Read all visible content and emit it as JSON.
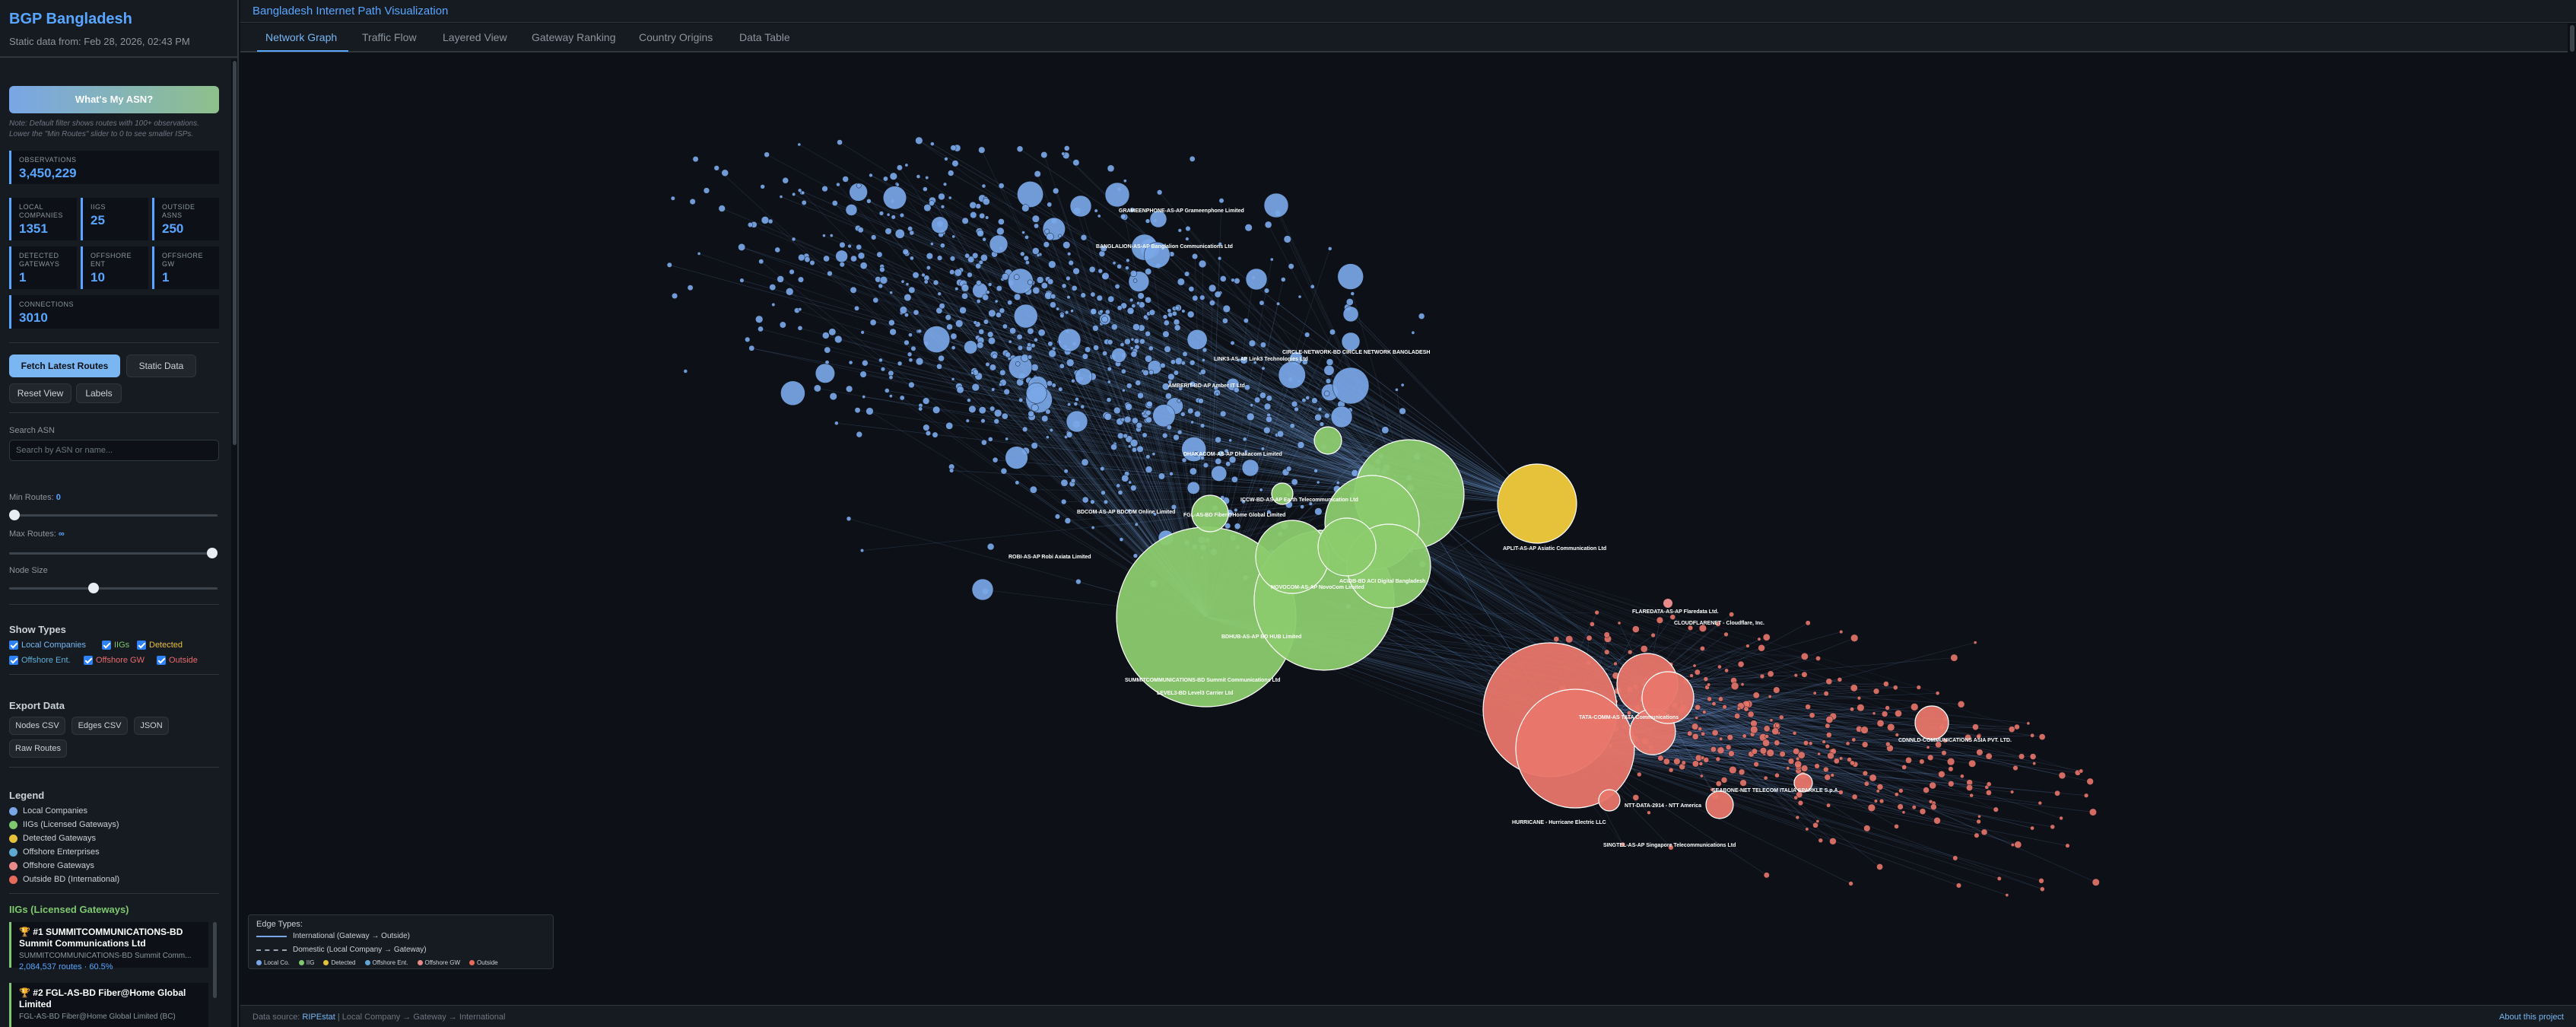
{
  "sidebar": {
    "title": "BGP Bangladesh",
    "subtitle": "Static data from: Feb 28, 2026, 02:43 PM",
    "asn_button": "What's My ASN?",
    "note": "Note: Default filter shows routes with 100+ observations. Lower the \"Min Routes\" slider to 0 to see smaller ISPs.",
    "stats": {
      "observations": {
        "label": "OBSERVATIONS",
        "value": "3,450,229"
      },
      "local_companies": {
        "label": "LOCAL COMPANIES",
        "value": "1351"
      },
      "iigs": {
        "label": "IIGS",
        "value": "25"
      },
      "outside_asns": {
        "label": "OUTSIDE ASNS",
        "value": "250"
      },
      "detected_gateways": {
        "label": "DETECTED GATEWAYS",
        "value": "1"
      },
      "offshore_ent": {
        "label": "OFFSHORE ENT",
        "value": "10"
      },
      "offshore_gw": {
        "label": "OFFSHORE GW",
        "value": "1"
      },
      "connections": {
        "label": "CONNECTIONS",
        "value": "3010"
      }
    },
    "fetch_button": "Fetch Latest Routes",
    "static_button": "Static Data",
    "reset_button": "Reset View",
    "labels_button": "Labels",
    "search": {
      "label": "Search ASN",
      "placeholder": "Search by ASN or name..."
    },
    "min_routes": {
      "label": "Min Routes: ",
      "value": "0",
      "fraction": 0.0
    },
    "max_routes": {
      "label": "Max Routes: ",
      "value": "∞",
      "fraction": 1.0
    },
    "node_size": {
      "label": "Node Size",
      "fraction": 0.4
    },
    "show_types": {
      "title": "Show Types",
      "items": [
        {
          "label": "Local Companies",
          "color": "#79b6f2"
        },
        {
          "label": "IIGs",
          "color": "#7ec86e"
        },
        {
          "label": "Detected",
          "color": "#e6c13a"
        },
        {
          "label": "Offshore Ent.",
          "color": "#5fb0d9"
        },
        {
          "label": "Offshore GW",
          "color": "#e86a6a"
        },
        {
          "label": "Outside",
          "color": "#e86a6a"
        }
      ]
    },
    "export": {
      "title": "Export Data",
      "nodes": "Nodes CSV",
      "edges": "Edges CSV",
      "json": "JSON",
      "raw": "Raw Routes"
    },
    "legend": {
      "title": "Legend",
      "items": [
        {
          "label": "Local Companies",
          "color": "#79a6e6"
        },
        {
          "label": "IIGs (Licensed Gateways)",
          "color": "#7ec86e"
        },
        {
          "label": "Detected Gateways",
          "color": "#e6c13a"
        },
        {
          "label": "Offshore Enterprises",
          "color": "#5fa8d3"
        },
        {
          "label": "Offshore Gateways",
          "color": "#e88a8a"
        },
        {
          "label": "Outside BD (International)",
          "color": "#e86a5a"
        }
      ]
    },
    "iig_list": {
      "title": "IIGs (Licensed Gateways)",
      "items": [
        {
          "name": "#1 SUMMITCOMMUNICATIONS-BD Summit Communications Ltd",
          "sub": "SUMMITCOMMUNICATIONS-BD Summit Comm...",
          "routes": "2,084,537 routes · 60.5%"
        },
        {
          "name": "#2 FGL-AS-BD Fiber@Home Global Limited",
          "sub": "FGL-AS-BD Fiber@Home Global Limited (BC)"
        }
      ]
    }
  },
  "main": {
    "title": "Bangladesh Internet Path Visualization",
    "tabs": [
      {
        "label": "Network Graph",
        "active": true
      },
      {
        "label": "Traffic Flow",
        "active": false
      },
      {
        "label": "Layered View",
        "active": false
      },
      {
        "label": "Gateway Ranking",
        "active": false
      },
      {
        "label": "Country Origins",
        "active": false
      },
      {
        "label": "Data Table",
        "active": false
      }
    ],
    "colors": {
      "local": "#7aa7e8",
      "iig": "#8ccb6e",
      "detected": "#e6c13a",
      "outside": "#e8766a",
      "edge": "#79a6e6"
    },
    "labels": {
      "green": [
        "SUMMITCOMMUNICATIONS-BD Summit Communications Ltd",
        "LEVEL3-BD Level3 Carrier Ltd",
        "ICCW-BD-AS-AP Earth Telecommunication Ltd",
        "FGL-AS-BD Fiber@Home Global Limited",
        "NOVOCOM-AS-AP NovoCom Limited",
        "BDHUB-AS-AP BD HUB Limited",
        "ACIDB-BD ACI Digital Bangladesh"
      ],
      "yellow": [
        "APLIT-AS-AP Asiatic Communication Ltd"
      ],
      "red": [
        "HURRICANE - Hurricane Electric LLC",
        "TATA-COMM-AS TATA Communications",
        "NTT-DATA-2914 - NTT America",
        "SINGTEL-AS-AP Singapore Telecommunications Ltd",
        "CDNNLD-COMMUNICATIONS ASIA PVT. LTD.",
        "FLAREDATA-AS-AP Flaredata Ltd.",
        "CLOUDFLARENET - Cloudflare, Inc.",
        "SEABONE-NET TELECOM ITALIA SPARKLE S.p.A."
      ],
      "blue": [
        "GRAMEENPHONE-AS-AP Grameenphone Limited",
        "BANGLALION-AS-AP Banglalion Communications Ltd",
        "LINK3-AS-AP Link3 Technologies Ltd",
        "AMBERIT-BD-AP Amber IT Ltd",
        "CIRCLE-NETWORK-BD CIRCLE NETWORK BANGLADESH",
        "DHAKACOM-AS-AP Dhakacom Limited",
        "BDCOM-AS-AP BDCOM Online Limited",
        "ROBI-AS-AP Robi Axiata Limited"
      ]
    },
    "edge_legend": {
      "title": "Edge Types:",
      "international": "International (Gateway → Outside)",
      "domestic": "Domestic (Local Company → Gateway)",
      "dots": [
        "Local Co.",
        "IIG",
        "Detected",
        "Offshore Ent.",
        "Offshore GW",
        "Outside"
      ]
    },
    "footer": {
      "prefix": "Data source: ",
      "source": "RIPEstat",
      "path": " | Local Company → Gateway → International",
      "about": "About this project"
    }
  }
}
